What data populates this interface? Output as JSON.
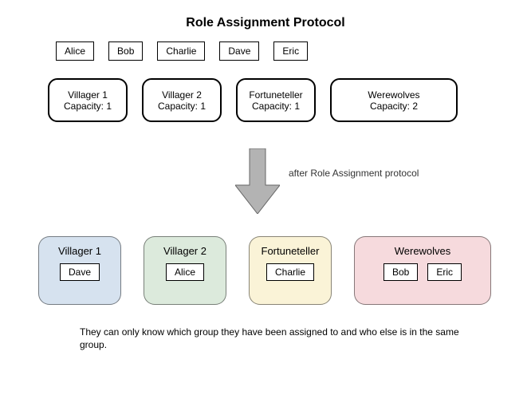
{
  "title": "Role Assignment Protocol",
  "players": [
    "Alice",
    "Bob",
    "Charlie",
    "Dave",
    "Eric"
  ],
  "roles_before": [
    {
      "name": "Villager 1",
      "capacity_label": "Capacity: 1",
      "size": "sm"
    },
    {
      "name": "Villager 2",
      "capacity_label": "Capacity: 1",
      "size": "sm"
    },
    {
      "name": "Fortuneteller",
      "capacity_label": "Capacity: 1",
      "size": "sm"
    },
    {
      "name": "Werewolves",
      "capacity_label": "Capacity: 2",
      "size": "lg"
    }
  ],
  "transition_label": "after Role Assignment protocol",
  "roles_after": [
    {
      "name": "Villager 1",
      "members": [
        "Dave"
      ],
      "color": "c-blue",
      "size": "sm"
    },
    {
      "name": "Villager 2",
      "members": [
        "Alice"
      ],
      "color": "c-green",
      "size": "sm"
    },
    {
      "name": "Fortuneteller",
      "members": [
        "Charlie"
      ],
      "color": "c-yellow",
      "size": "sm"
    },
    {
      "name": "Werewolves",
      "members": [
        "Bob",
        "Eric"
      ],
      "color": "c-pink",
      "size": "lg"
    }
  ],
  "footnote": "They can only know which group they have been assigned to and who else is in the same group."
}
